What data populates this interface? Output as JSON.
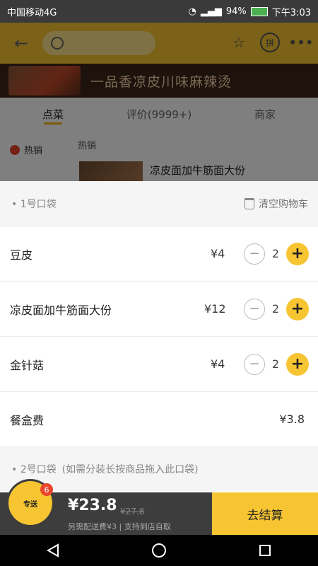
{
  "status": {
    "carrier": "中国移动4G",
    "battery": "94%",
    "time": "下午3:03"
  },
  "banner": {
    "title": "一品香凉皮川味麻辣烫"
  },
  "tabs": [
    {
      "label": "点菜"
    },
    {
      "label": "评价(9999+)"
    },
    {
      "label": "商家"
    }
  ],
  "menu": {
    "side_item": "热销",
    "section_title": "热销",
    "product_name": "凉皮面加牛筋面大份"
  },
  "cart": {
    "bag1_label": "• 1号口袋",
    "clear_label": "清空购物车",
    "items": [
      {
        "name": "豆皮",
        "price": "¥4",
        "qty": "2"
      },
      {
        "name": "凉皮面加牛筋面大份",
        "price": "¥12",
        "qty": "2"
      },
      {
        "name": "金针菇",
        "price": "¥4",
        "qty": "2"
      }
    ],
    "fee_name": "餐盒费",
    "fee_price": "¥3.8",
    "bag2_label": "• 2号口袋",
    "bag2_hint": "(如需分装长按商品拖入此口袋)"
  },
  "bottom": {
    "total": "¥23.8",
    "original": "¥27.8",
    "delivery": "另需配送费¥3 | 支持到店自取",
    "checkout": "去结算",
    "logo_text": "专送",
    "badge": "6"
  },
  "colors": {
    "accent": "#f7c531",
    "dark": "#3d3d3d",
    "badge": "#e8452c"
  }
}
